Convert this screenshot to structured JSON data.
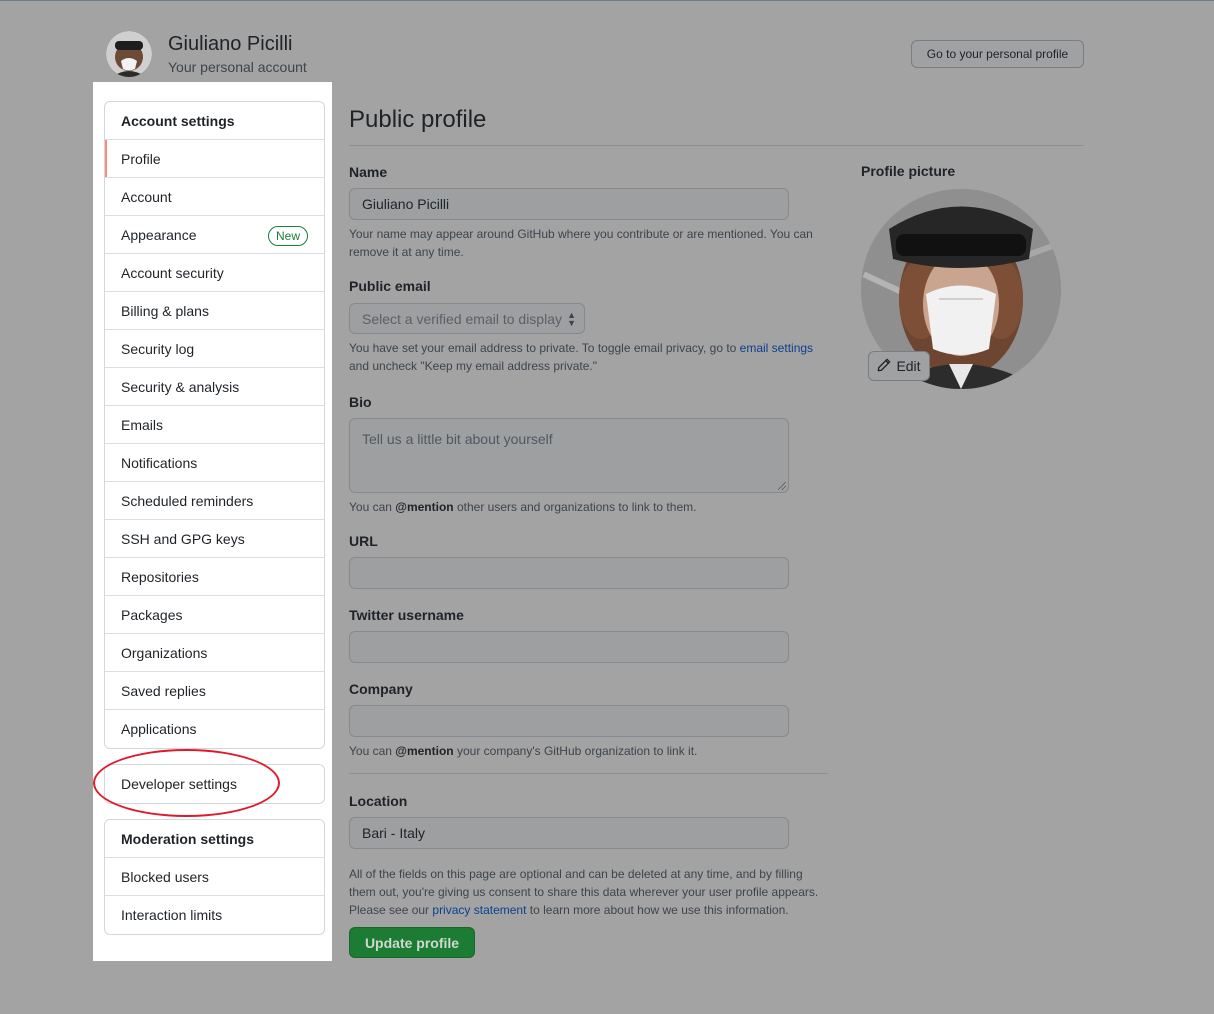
{
  "header": {
    "user_name": "Giuliano Picilli",
    "user_subtitle": "Your personal account",
    "go_to_profile_label": "Go to your personal profile"
  },
  "sidebar": {
    "account_group": [
      {
        "label": "Account settings",
        "heading": true
      },
      {
        "label": "Profile",
        "selected": true
      },
      {
        "label": "Account"
      },
      {
        "label": "Appearance",
        "badge": "New"
      },
      {
        "label": "Account security"
      },
      {
        "label": "Billing & plans"
      },
      {
        "label": "Security log"
      },
      {
        "label": "Security & analysis"
      },
      {
        "label": "Emails"
      },
      {
        "label": "Notifications"
      },
      {
        "label": "Scheduled reminders"
      },
      {
        "label": "SSH and GPG keys"
      },
      {
        "label": "Repositories"
      },
      {
        "label": "Packages"
      },
      {
        "label": "Organizations"
      },
      {
        "label": "Saved replies"
      },
      {
        "label": "Applications"
      }
    ],
    "developer_settings": "Developer settings",
    "moderation_group": [
      {
        "label": "Moderation settings",
        "heading": true
      },
      {
        "label": "Blocked users"
      },
      {
        "label": "Interaction limits"
      }
    ],
    "badge_color": "#1a7f37",
    "selected_indicator_color": "#fd8c73",
    "annotation_color": "#e0192b"
  },
  "main": {
    "title": "Public profile",
    "name": {
      "label": "Name",
      "value": "Giuliano Picilli",
      "note": "Your name may appear around GitHub where you contribute or are mentioned. You can remove it at any time."
    },
    "public_email": {
      "label": "Public email",
      "selected": "Select a verified email to display",
      "note_before": "You have set your email address to private. To toggle email privacy, go to ",
      "note_link": "email settings",
      "note_after": " and uncheck \"Keep my email address private.\""
    },
    "bio": {
      "label": "Bio",
      "placeholder": "Tell us a little bit about yourself",
      "note_before": "You can ",
      "note_bold": "@mention",
      "note_after": " other users and organizations to link to them."
    },
    "url": {
      "label": "URL",
      "value": ""
    },
    "twitter": {
      "label": "Twitter username",
      "value": ""
    },
    "company": {
      "label": "Company",
      "value": "",
      "note_before": "You can ",
      "note_bold": "@mention",
      "note_after": " your company's GitHub organization to link it."
    },
    "location": {
      "label": "Location",
      "value": "Bari - Italy"
    },
    "footer_note_before": "All of the fields on this page are optional and can be deleted at any time, and by filling them out, you're giving us consent to share this data wherever your user profile appears. Please see our ",
    "footer_note_link": "privacy statement",
    "footer_note_after": " to learn more about how we use this information.",
    "update_button": "Update profile",
    "update_button_color": "#1c7c33"
  },
  "profile_picture": {
    "label": "Profile picture",
    "edit_label": "Edit",
    "edit_icon": "pencil-icon"
  }
}
